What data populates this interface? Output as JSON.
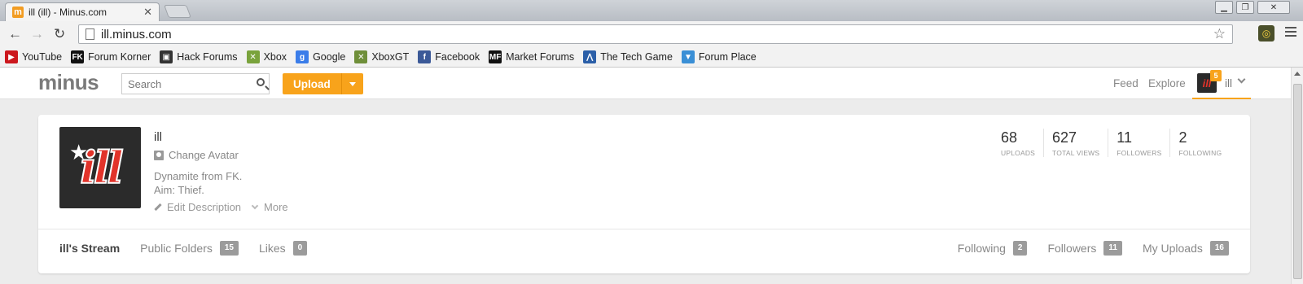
{
  "browser": {
    "tab_title": "ill (ill) - Minus.com",
    "tab_favicon": "m",
    "url": "ill.minus.com",
    "bookmarks": [
      {
        "label": "YouTube",
        "icon": "youtube-icon",
        "color": "#cc181e",
        "glyph": "▶"
      },
      {
        "label": "Forum Korner",
        "icon": "fk-icon",
        "color": "#111111",
        "glyph": "FK"
      },
      {
        "label": "Hack Forums",
        "icon": "hackforums-icon",
        "color": "#333333",
        "glyph": "▣"
      },
      {
        "label": "Xbox",
        "icon": "xbox-icon",
        "color": "#7aa33c",
        "glyph": "✕"
      },
      {
        "label": "Google",
        "icon": "google-icon",
        "color": "#3b7de9",
        "glyph": "g"
      },
      {
        "label": "XboxGT",
        "icon": "xboxgt-icon",
        "color": "#6f8f3a",
        "glyph": "✕"
      },
      {
        "label": "Facebook",
        "icon": "facebook-icon",
        "color": "#3b5998",
        "glyph": "f"
      },
      {
        "label": "Market Forums",
        "icon": "mf-icon",
        "color": "#111111",
        "glyph": "MF"
      },
      {
        "label": "The Tech Game",
        "icon": "techgame-icon",
        "color": "#2b5fa8",
        "glyph": "⋀"
      },
      {
        "label": "Forum Place",
        "icon": "forumplace-icon",
        "color": "#3a8fd6",
        "glyph": "▼"
      }
    ]
  },
  "header": {
    "logo": "minus",
    "search_placeholder": "Search",
    "upload_label": "Upload",
    "nav_feed": "Feed",
    "nav_explore": "Explore",
    "notification_count": "5",
    "user_name": "ill",
    "user_avatar_text": "ill"
  },
  "profile": {
    "avatar_text": "ill",
    "name": "ill",
    "change_avatar": "Change Avatar",
    "description_line1": "Dynamite from FK.",
    "description_line2": "Aim: Thief.",
    "edit_description": "Edit Description",
    "more": "More",
    "stats": [
      {
        "value": "68",
        "label": "UPLOADS"
      },
      {
        "value": "627",
        "label": "TOTAL VIEWS"
      },
      {
        "value": "11",
        "label": "FOLLOWERS"
      },
      {
        "value": "2",
        "label": "FOLLOWING"
      }
    ],
    "tabs_left": [
      {
        "label": "ill's Stream",
        "count": ""
      },
      {
        "label": "Public Folders",
        "count": "15"
      },
      {
        "label": "Likes",
        "count": "0"
      }
    ],
    "tabs_right": [
      {
        "label": "Following",
        "count": "2"
      },
      {
        "label": "Followers",
        "count": "11"
      },
      {
        "label": "My Uploads",
        "count": "16"
      }
    ]
  },
  "colors": {
    "accent": "#f8a31b",
    "avatar_red": "#e2332a",
    "badge_gray": "#9b9b9b"
  }
}
